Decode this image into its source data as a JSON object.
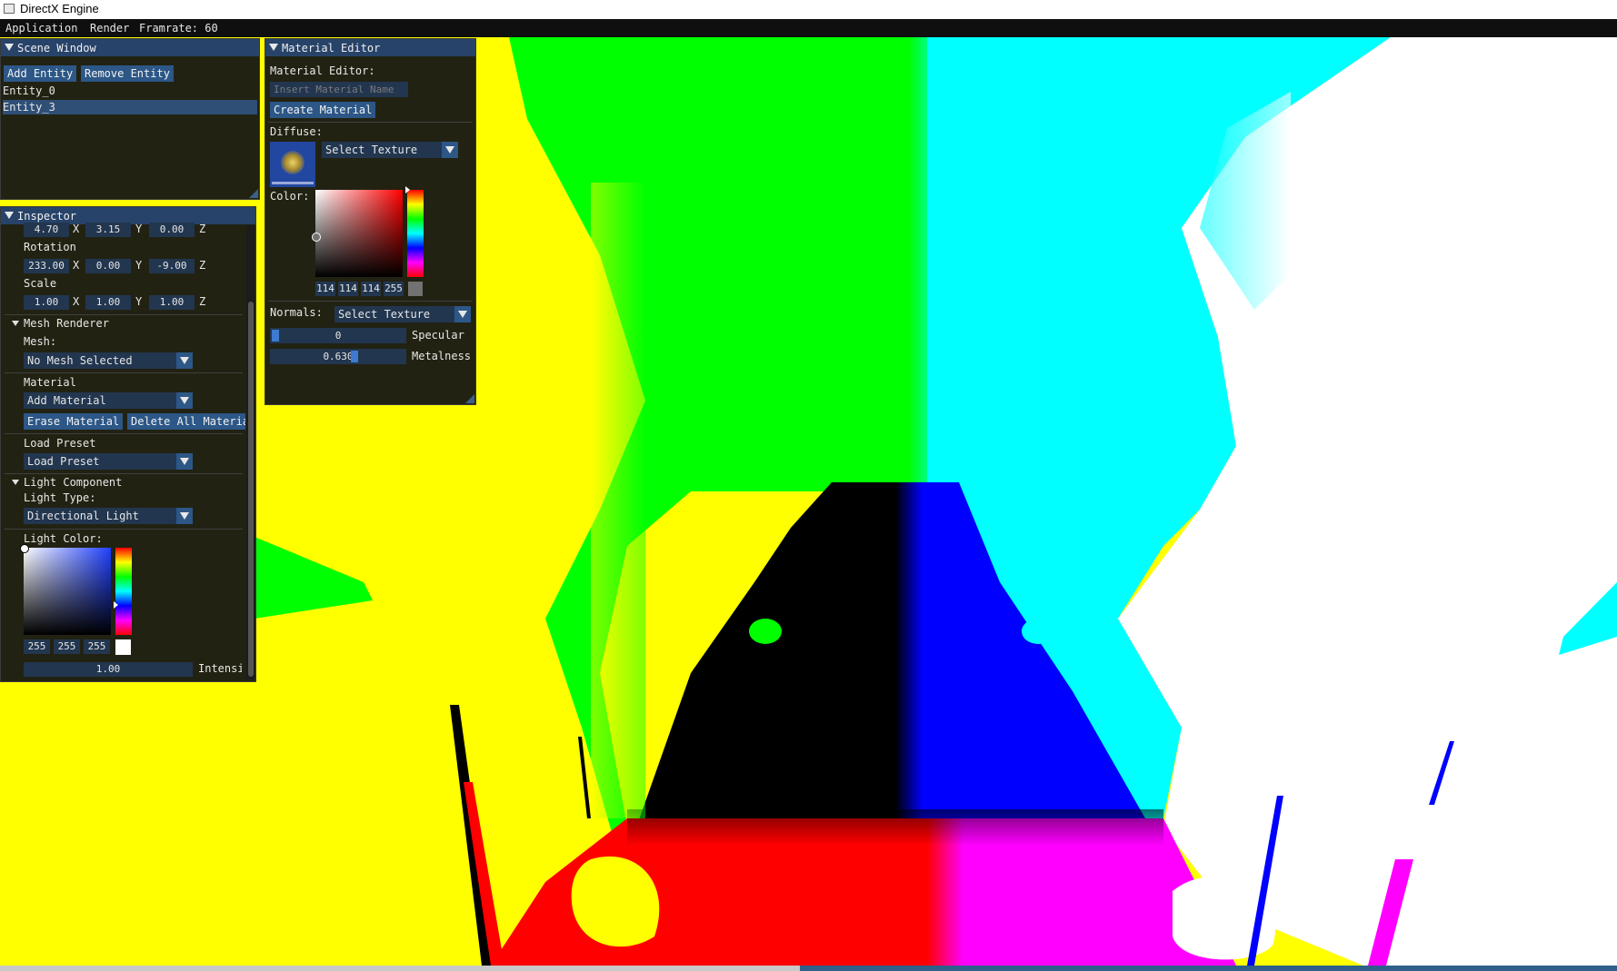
{
  "window": {
    "title": "DirectX Engine"
  },
  "menubar": {
    "items": [
      "Application",
      "Render"
    ],
    "framerate": "Framrate: 60"
  },
  "scene_window": {
    "title": "Scene Window",
    "add_entity": "Add Entity",
    "remove_entity": "Remove Entity",
    "entities": [
      "Entity_0",
      "Entity_3"
    ],
    "selected_index": 1
  },
  "inspector": {
    "title": "Inspector",
    "position": {
      "x": "4.70",
      "y": "3.15",
      "z": "0.00"
    },
    "rotation_label": "Rotation",
    "rotation": {
      "x": "233.00",
      "y": "0.00",
      "z": "-9.00"
    },
    "scale_label": "Scale",
    "scale": {
      "x": "1.00",
      "y": "1.00",
      "z": "1.00"
    },
    "axis": {
      "x": "X",
      "y": "Y",
      "z": "Z"
    },
    "mesh_renderer": {
      "header": "Mesh Renderer",
      "mesh_label": "Mesh:",
      "mesh_value": "No Mesh Selected",
      "material_label": "Material",
      "material_value": "Add Material",
      "erase_material": "Erase Material",
      "delete_all": "Delete All Materia",
      "preset_label": "Load Preset",
      "preset_value": "Load Preset"
    },
    "light": {
      "header": "Light Component",
      "type_label": "Light Type:",
      "type_value": "Directional Light",
      "color_label": "Light Color:",
      "rgba": [
        "255",
        "255",
        "255"
      ],
      "swatch": "#ffffff",
      "intensity": "1.00",
      "intensity_label": "Intensi"
    }
  },
  "material_editor": {
    "title": "Material Editor",
    "heading": "Material Editor:",
    "name_placeholder": "Insert Material Name",
    "create": "Create Material",
    "diffuse_label": "Diffuse:",
    "diffuse_texture": "Select Texture",
    "color_label": "Color:",
    "rgba": [
      "114",
      "114",
      "114",
      "255"
    ],
    "swatch": "#727272",
    "normals_label": "Normals:",
    "normals_texture": "Select Texture",
    "specular_value": "0",
    "specular_label": "Specular",
    "specular_fraction": 0.0,
    "metalness_value": "0.630",
    "metalness_label": "Metalness",
    "metalness_fraction": 0.63
  },
  "colors": {
    "title_bg": "#274369",
    "button": "#2c5787",
    "frame": "#22364f",
    "scene_yellow": "#ffff00",
    "scene_green": "#00ff00",
    "scene_cyan": "#00ffff",
    "scene_white": "#ffffff",
    "scene_black": "#000000",
    "scene_blue": "#0000ff",
    "scene_red": "#ff0000",
    "scene_magenta": "#ff00ff"
  }
}
